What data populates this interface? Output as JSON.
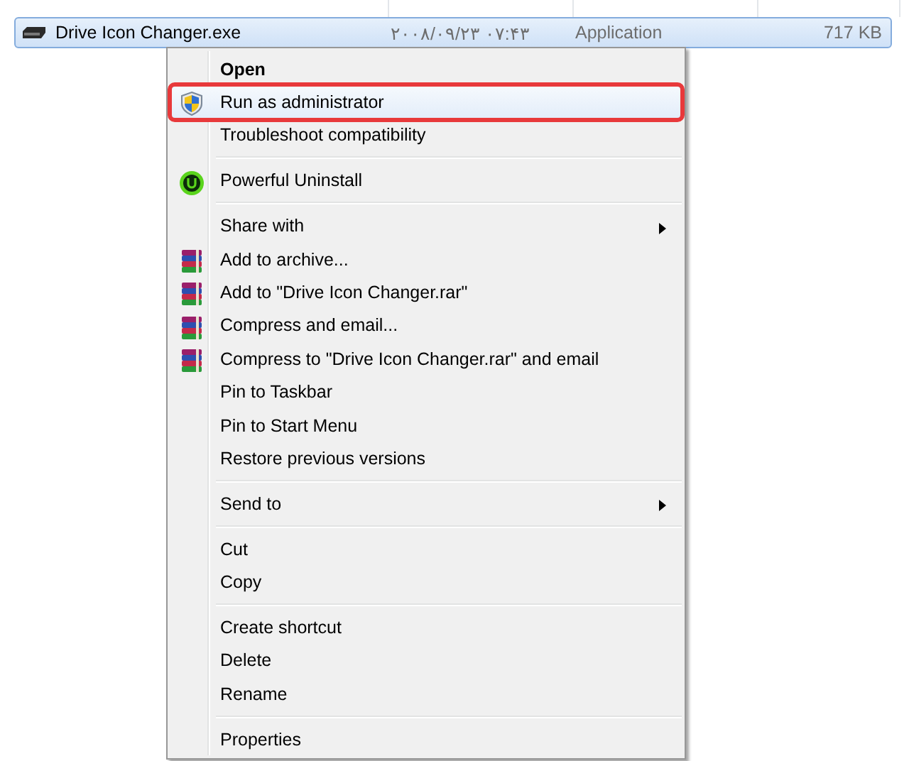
{
  "file_row": {
    "name": "Drive Icon Changer.exe",
    "date_modified": "۲۰۰۸/۰۹/۲۳ ۰۷:۴۳",
    "type": "Application",
    "size": "717 KB",
    "selected": true
  },
  "context_menu": [
    {
      "kind": "item",
      "label": "Open",
      "bold": true
    },
    {
      "kind": "admin",
      "label": "Run as administrator",
      "selected": true,
      "marked": true
    },
    {
      "kind": "item",
      "label": "Troubleshoot compatibility"
    },
    {
      "kind": "separator"
    },
    {
      "kind": "uninstaller",
      "label": "Powerful Uninstall"
    },
    {
      "kind": "separator"
    },
    {
      "kind": "item",
      "label": "Share with",
      "submenu": true
    },
    {
      "kind": "archive",
      "label": "Add to archive..."
    },
    {
      "kind": "archive",
      "label": "Add to \"Drive Icon Changer.rar\""
    },
    {
      "kind": "archive",
      "label": "Compress and email..."
    },
    {
      "kind": "archive",
      "label": "Compress to \"Drive Icon Changer.rar\" and email"
    },
    {
      "kind": "item",
      "label": "Pin to Taskbar"
    },
    {
      "kind": "item",
      "label": "Pin to Start Menu"
    },
    {
      "kind": "item",
      "label": "Restore previous versions"
    },
    {
      "kind": "separator"
    },
    {
      "kind": "item",
      "label": "Send to",
      "submenu": true
    },
    {
      "kind": "separator"
    },
    {
      "kind": "item",
      "label": "Cut"
    },
    {
      "kind": "item",
      "label": "Copy"
    },
    {
      "kind": "separator"
    },
    {
      "kind": "item",
      "label": "Create shortcut"
    },
    {
      "kind": "item",
      "label": "Delete"
    },
    {
      "kind": "item",
      "label": "Rename"
    },
    {
      "kind": "separator"
    },
    {
      "kind": "item",
      "label": "Properties"
    }
  ]
}
